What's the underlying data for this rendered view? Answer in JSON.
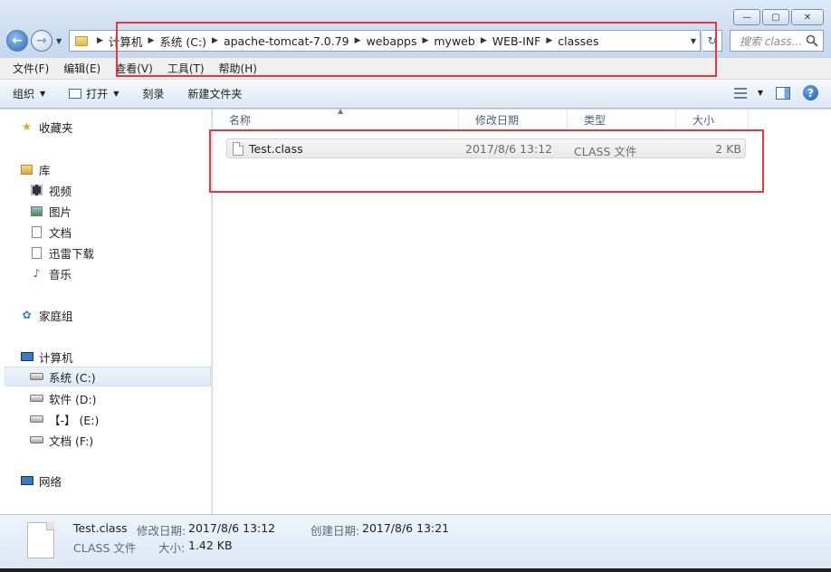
{
  "window": {
    "min_glyph": "—",
    "max_glyph": "▢",
    "close_glyph": "✕"
  },
  "address": {
    "crumbs": [
      "计算机",
      "系统 (C:)",
      "apache-tomcat-7.0.79",
      "webapps",
      "myweb",
      "WEB-INF",
      "classes"
    ],
    "search_placeholder": "搜索 class..."
  },
  "menu": [
    "文件(F)",
    "编辑(E)",
    "查看(V)",
    "工具(T)",
    "帮助(H)"
  ],
  "toolbar": {
    "organize": "组织",
    "open": "打开",
    "burn": "刻录",
    "new_folder": "新建文件夹"
  },
  "nav": {
    "favorites": "收藏夹",
    "library": "库",
    "video": "视频",
    "pictures": "图片",
    "documents": "文档",
    "xunlei": "迅雷下载",
    "music": "音乐",
    "homegroup": "家庭组",
    "computer": "计算机",
    "drive_c": "系统 (C:)",
    "drive_d": "软件 (D:)",
    "drive_e": "【-】 (E:)",
    "drive_f": "文档 (F:)",
    "network": "网络"
  },
  "columns": {
    "name": "名称",
    "modified": "修改日期",
    "type": "类型",
    "size": "大小"
  },
  "files": [
    {
      "name": "Test.class",
      "modified": "2017/8/6 13:12",
      "type": "CLASS 文件",
      "size": "2 KB"
    }
  ],
  "details": {
    "name": "Test.class",
    "type": "CLASS 文件",
    "modified_label": "修改日期:",
    "modified": "2017/8/6 13:12",
    "created_label": "创建日期:",
    "created": "2017/8/6 13:21",
    "size_label": "大小:",
    "size": "1.42 KB"
  },
  "colors": {
    "highlight": "#e8383d",
    "accent": "#2f6bb8"
  }
}
